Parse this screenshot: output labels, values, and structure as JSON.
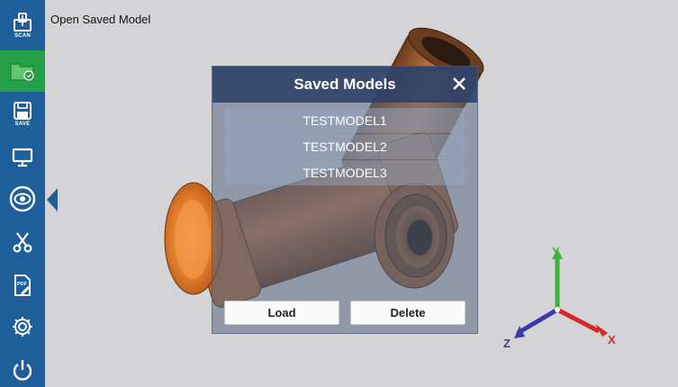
{
  "page": {
    "title": "Open Saved Model"
  },
  "sidebar": {
    "items": [
      {
        "name": "scan",
        "icon": "scan-icon",
        "label": "SCAN"
      },
      {
        "name": "open-model",
        "icon": "folder-open-icon",
        "label": "",
        "active": true
      },
      {
        "name": "save",
        "icon": "save-icon",
        "label": "SAVE"
      },
      {
        "name": "display",
        "icon": "monitor-icon",
        "label": ""
      },
      {
        "name": "view",
        "icon": "eye-icon",
        "label": ""
      },
      {
        "name": "cut",
        "icon": "scissors-icon",
        "label": ""
      },
      {
        "name": "pdf-report",
        "icon": "pdf-edit-icon",
        "label": "PDF"
      },
      {
        "name": "settings",
        "icon": "gear-icon",
        "label": ""
      },
      {
        "name": "power",
        "icon": "power-icon",
        "label": ""
      }
    ],
    "color": "#1e5f9b",
    "active_color": "#24a04a"
  },
  "dialog": {
    "title": "Saved Models",
    "close_icon": "close-icon",
    "models": [
      "TESTMODEL1",
      "TESTMODEL2",
      "TESTMODEL3"
    ],
    "load_label": "Load",
    "delete_label": "Delete"
  },
  "axes": {
    "x_label": "X",
    "y_label": "Y",
    "z_label": "Z",
    "x_color": "#d22a2a",
    "y_color": "#3cb43c",
    "z_color": "#3a3aa8"
  },
  "model": {
    "color": "#c87a3a"
  }
}
